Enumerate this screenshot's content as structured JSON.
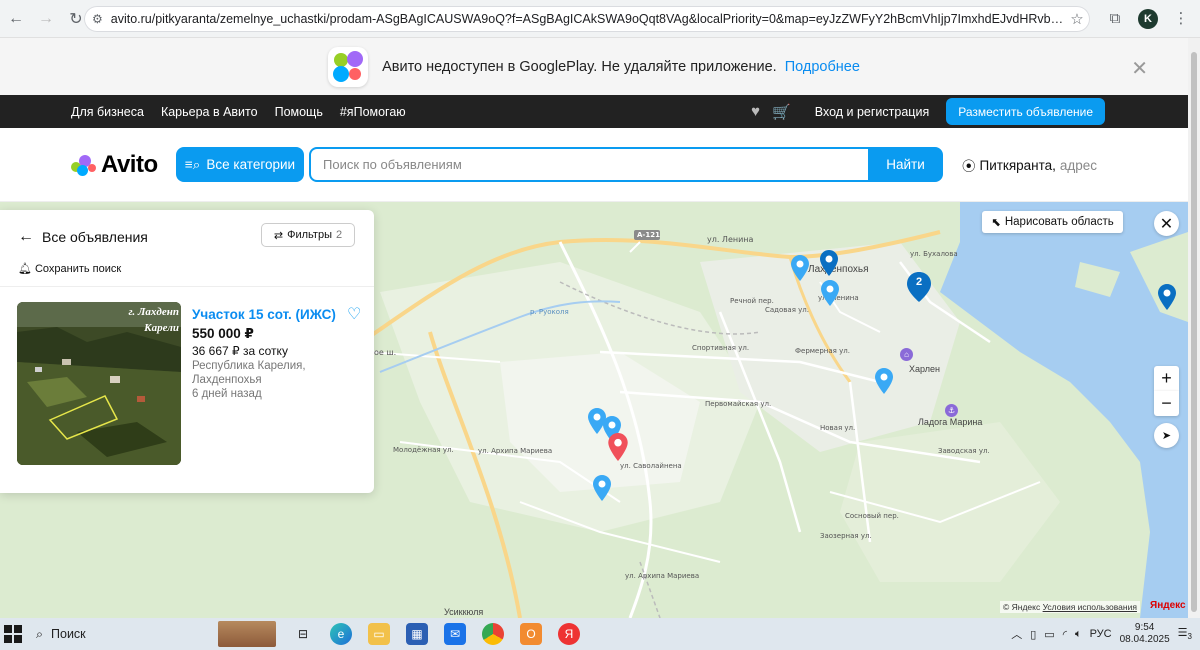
{
  "browser": {
    "url": "avito.ru/pitkyaranta/zemelnye_uchastki/prodam-ASgBAgICAUSWA9oQ?f=ASgBAgICAkSWA9oQqt8VAg&localPriority=0&map=eyJzZWFyY2hBcmVhIjp7ImxhdEJvdHRvbSI6NjEuNTAzMTQyOTkx...",
    "profile_initial": "K"
  },
  "banner": {
    "text": "Авито недоступен в GooglePlay. Не удаляйте приложение.",
    "link": "Подробнее"
  },
  "top_nav": {
    "links": [
      "Для бизнеса",
      "Карьера в Авито",
      "Помощь",
      "#яПомогаю"
    ],
    "login": "Вход и регистрация",
    "post_button": "Разместить объявление"
  },
  "header": {
    "logo": "Avito",
    "categories_button": "Все категории",
    "search_placeholder": "Поиск по объявлениям",
    "search_button": "Найти",
    "location_city": "Питкяранта,",
    "location_address": "адрес"
  },
  "panel": {
    "back_label": "Все объявления",
    "filters_label": "Фильтры",
    "filters_count": "2",
    "save_search": "Сохранить поиск",
    "listing": {
      "title": "Участок 15 сот. (ИЖС)",
      "price": "550 000 ₽",
      "price_per": "36 667 ₽ за сотку",
      "region": "Республика Карелия,",
      "town": "Лахденпохья",
      "date": "6 дней назад",
      "photo_caption_1": "г. Лахденп",
      "photo_caption_2": "Карели"
    }
  },
  "map": {
    "draw_area": "Нарисовать область",
    "copyright": "© Яндекс",
    "terms": "Условия использования",
    "brand": "Яндекс",
    "cluster_count": "2",
    "labels": {
      "lenina": "ул. Ленина",
      "a121": "А-121",
      "town": "Лахденпохья",
      "harlen": "Харлен",
      "ladoga": "Ладога Марина",
      "usikkula": "Усиккюля",
      "pervomayskaya": "Первомайская ул.",
      "sportivnaya": "Спортивная ул.",
      "fermernaya": "Фермерная ул.",
      "novaya": "Новая ул.",
      "zavodskaya": "Заводская ул.",
      "sosnovy": "Сосновый пер.",
      "zaozernaya": "Заозерная ул.",
      "molodezhnaya": "Молодёжная ул.",
      "arkhipa": "ул. Архипа Мариева",
      "savolaynen": "ул. Саволайнена",
      "rechnoy": "Речной пер.",
      "sadovaya": "Садовая ул.",
      "bukhalova": "ул. Бухалова",
      "lenina2": "ул. Ленина",
      "ruokola": "р. Руоколя",
      "arkhipa2": "ул. Архипа Мариева",
      "oe_sh": "ое ш."
    }
  },
  "taskbar": {
    "search": "Поиск",
    "lang": "РУС",
    "time": "9:54",
    "date": "08.04.2025",
    "notifications": "3"
  },
  "colors": {
    "accent": "#0a9bf0",
    "pin_blue": "#3aa9f5",
    "pin_red": "#f0505a",
    "dark_nav": "#222222",
    "map_green": "#cfe4c0",
    "water": "#a6cdf1"
  }
}
